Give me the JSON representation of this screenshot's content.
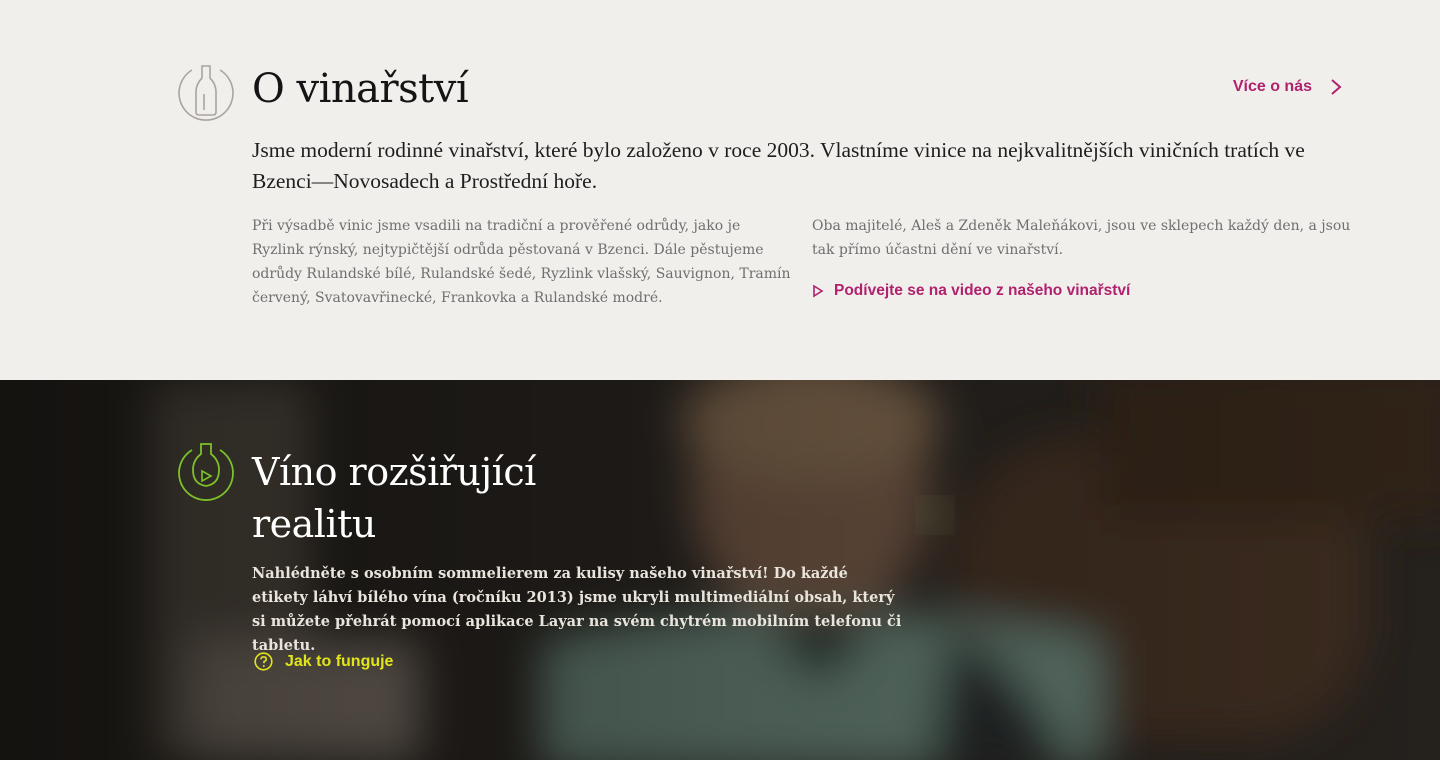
{
  "brand": {
    "logo_icon": "vineyard-logo-icon",
    "accent_green": "#7cc12a",
    "accent_magenta": "#b0226e",
    "accent_yellow": "#e2e41a"
  },
  "about": {
    "icon": "wine-bottle-icon",
    "title": "O vinařství",
    "more_link": "Více o nás",
    "lead": "Jsme moderní rodinné vinařství, které bylo založeno v roce 2003. Vlastníme vinice na nejkvalitnějších viničních tratích ve Bzenci—Novosadech a Prostřední hoře.",
    "col_left": "Při výsadbě vinic jsme vsadili na tradiční a prověřené odrůdy, jako je Ryzlink rýnský, nejtypičtější odrůda pěstovaná v Bzenci. Dále pěstujeme odrůdy Rulandské bílé, Rulandské šedé, Ryzlink vlašský, Sauvignon, Tramín červený, Svatovavřinecké, Frankovka a Rulandské modré.",
    "col_right": "Oba majitelé, Aleš a Zdeněk Maleňákovi, jsou ve sklepech každý den, a jsou tak přímo účastni dění ve vinařství.",
    "video_link": "Podívejte se na video z našeho vinařství"
  },
  "ar": {
    "icon": "bottle-play-icon",
    "title": "Víno rozšiřující realitu",
    "description": "Nahlédněte s osobním sommelierem za kulisy našeho vinařství! Do každé etikety láhví bílého vína (ročníku 2013) jsme ukryli multimediální obsah, který si můžete přehrát pomocí aplikace Layar na svém chytrém mobilním telefonu či tabletu.",
    "how_link": "Jak to funguje"
  }
}
